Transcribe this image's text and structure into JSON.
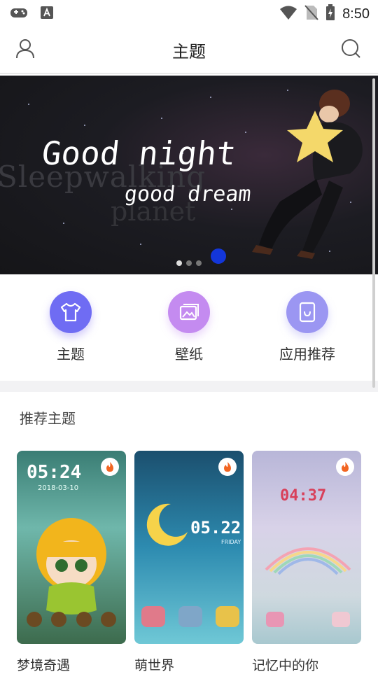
{
  "status_bar": {
    "time": "8:50"
  },
  "header": {
    "title": "主题"
  },
  "banner": {
    "line1": "Good night",
    "line2": "good dream",
    "ghost_line1": "Sleepwalking",
    "ghost_line2": "planet",
    "page_count": 3,
    "active_page": 1
  },
  "quick_actions": [
    {
      "label": "主题",
      "icon": "tshirt-icon",
      "color": "#6f6cf3"
    },
    {
      "label": "壁纸",
      "icon": "picture-icon",
      "color": "#c48bf0"
    },
    {
      "label": "应用推荐",
      "icon": "app-box-icon",
      "color": "#9b96f2"
    }
  ],
  "recommend": {
    "title": "推荐主题",
    "items": [
      {
        "name": "梦境奇遇",
        "clock_time": "05:24",
        "clock_date": "2018-03-10"
      },
      {
        "name": "萌世界",
        "clock_time": "05.22",
        "clock_day": "FRIDAY"
      },
      {
        "name": "记忆中的你",
        "clock_time": "04:37"
      }
    ]
  }
}
